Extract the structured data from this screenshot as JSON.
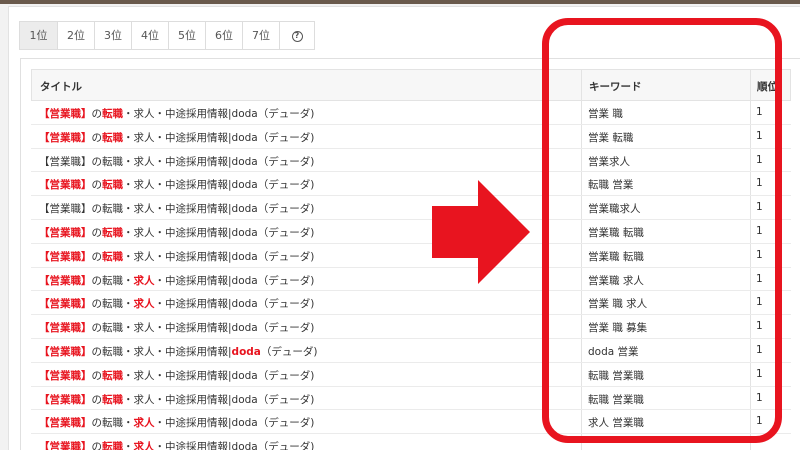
{
  "tabs": [
    {
      "label": "1位",
      "active": true
    },
    {
      "label": "2位",
      "active": false
    },
    {
      "label": "3位",
      "active": false
    },
    {
      "label": "4位",
      "active": false
    },
    {
      "label": "5位",
      "active": false
    },
    {
      "label": "6位",
      "active": false
    },
    {
      "label": "7位",
      "active": false
    }
  ],
  "help_label": "?",
  "columns": {
    "title": "タイトル",
    "keyword": "キーワード",
    "rank": "順位"
  },
  "highlight_color": "#e8141f",
  "rows": [
    {
      "title": [
        {
          "t": "【",
          "h": true
        },
        {
          "t": "営業職",
          "h": true
        },
        {
          "t": "】",
          "h": true
        },
        {
          "t": "の",
          "h": false
        },
        {
          "t": "転職",
          "h": true
        },
        {
          "t": "・求人・中途採用情報|doda（デューダ)",
          "h": false
        }
      ],
      "keyword": "営業 職",
      "rank": "1"
    },
    {
      "title": [
        {
          "t": "【",
          "h": true
        },
        {
          "t": "営業職",
          "h": true
        },
        {
          "t": "】",
          "h": true
        },
        {
          "t": "の",
          "h": false
        },
        {
          "t": "転職",
          "h": true
        },
        {
          "t": "・求人・中途採用情報|doda（デューダ)",
          "h": false
        }
      ],
      "keyword": "営業 転職",
      "rank": "1"
    },
    {
      "title": [
        {
          "t": "【営業職】の転職・求人・中途採用情報|doda（デューダ)",
          "h": false
        }
      ],
      "keyword": "営業求人",
      "rank": "1"
    },
    {
      "title": [
        {
          "t": "【",
          "h": true
        },
        {
          "t": "営業職",
          "h": true
        },
        {
          "t": "】",
          "h": true
        },
        {
          "t": "の",
          "h": false
        },
        {
          "t": "転職",
          "h": true
        },
        {
          "t": "・求人・中途採用情報|doda（デューダ)",
          "h": false
        }
      ],
      "keyword": "転職 営業",
      "rank": "1"
    },
    {
      "title": [
        {
          "t": "【営業職】の転職・求人・中途採用情報|doda（デューダ)",
          "h": false
        }
      ],
      "keyword": "営業職求人",
      "rank": "1"
    },
    {
      "title": [
        {
          "t": "【",
          "h": true
        },
        {
          "t": "営業職",
          "h": true
        },
        {
          "t": "】",
          "h": true
        },
        {
          "t": "の",
          "h": false
        },
        {
          "t": "転職",
          "h": true
        },
        {
          "t": "・求人・中途採用情報|doda（デューダ)",
          "h": false
        }
      ],
      "keyword": "営業職 転職",
      "rank": "1"
    },
    {
      "title": [
        {
          "t": "【",
          "h": true
        },
        {
          "t": "営業職",
          "h": true
        },
        {
          "t": "】",
          "h": true
        },
        {
          "t": "の",
          "h": false
        },
        {
          "t": "転職",
          "h": true
        },
        {
          "t": "・求人・中途採用情報|doda（デューダ)",
          "h": false
        }
      ],
      "keyword": "営業職 転職",
      "rank": "1"
    },
    {
      "title": [
        {
          "t": "【",
          "h": true
        },
        {
          "t": "営業職",
          "h": true
        },
        {
          "t": "】",
          "h": true
        },
        {
          "t": "の転職・",
          "h": false
        },
        {
          "t": "求人",
          "h": true
        },
        {
          "t": "・中途採用情報|doda（デューダ)",
          "h": false
        }
      ],
      "keyword": "営業職 求人",
      "rank": "1"
    },
    {
      "title": [
        {
          "t": "【",
          "h": true
        },
        {
          "t": "営業職",
          "h": true
        },
        {
          "t": "】",
          "h": true
        },
        {
          "t": "の転職・",
          "h": false
        },
        {
          "t": "求人",
          "h": true
        },
        {
          "t": "・中途採用情報|doda（デューダ)",
          "h": false
        }
      ],
      "keyword": "営業 職 求人",
      "rank": "1"
    },
    {
      "title": [
        {
          "t": "【",
          "h": true
        },
        {
          "t": "営業職",
          "h": true
        },
        {
          "t": "】",
          "h": true
        },
        {
          "t": "の転職・求人・中途採用情報|doda（デューダ)",
          "h": false
        }
      ],
      "keyword": "営業 職 募集",
      "rank": "1"
    },
    {
      "title": [
        {
          "t": "【",
          "h": true
        },
        {
          "t": "営業職",
          "h": true
        },
        {
          "t": "】",
          "h": true
        },
        {
          "t": "の転職・求人・中途採用情報|",
          "h": false
        },
        {
          "t": "doda",
          "h": true
        },
        {
          "t": "（デューダ)",
          "h": false
        }
      ],
      "keyword": "doda 営業",
      "rank": "1"
    },
    {
      "title": [
        {
          "t": "【",
          "h": true
        },
        {
          "t": "営業職",
          "h": true
        },
        {
          "t": "】",
          "h": true
        },
        {
          "t": "の",
          "h": false
        },
        {
          "t": "転職",
          "h": true
        },
        {
          "t": "・求人・中途採用情報|doda（デューダ)",
          "h": false
        }
      ],
      "keyword": "転職 営業職",
      "rank": "1"
    },
    {
      "title": [
        {
          "t": "【",
          "h": true
        },
        {
          "t": "営業職",
          "h": true
        },
        {
          "t": "】",
          "h": true
        },
        {
          "t": "の",
          "h": false
        },
        {
          "t": "転職",
          "h": true
        },
        {
          "t": "・求人・中途採用情報|doda（デューダ)",
          "h": false
        }
      ],
      "keyword": "転職 営業職",
      "rank": "1"
    },
    {
      "title": [
        {
          "t": "【",
          "h": true
        },
        {
          "t": "営業職",
          "h": true
        },
        {
          "t": "】",
          "h": true
        },
        {
          "t": "の転職・",
          "h": false
        },
        {
          "t": "求人",
          "h": true
        },
        {
          "t": "・中途採用情報|doda（デューダ)",
          "h": false
        }
      ],
      "keyword": "求人 営業職",
      "rank": "1"
    },
    {
      "title": [
        {
          "t": "【",
          "h": true
        },
        {
          "t": "営業職",
          "h": true
        },
        {
          "t": "】",
          "h": true
        },
        {
          "t": "の",
          "h": false
        },
        {
          "t": "転職",
          "h": true
        },
        {
          "t": "・",
          "h": false
        },
        {
          "t": "求人",
          "h": true
        },
        {
          "t": "・中途採用情報|doda（デューダ)",
          "h": false
        }
      ],
      "keyword": "",
      "rank": ""
    }
  ]
}
